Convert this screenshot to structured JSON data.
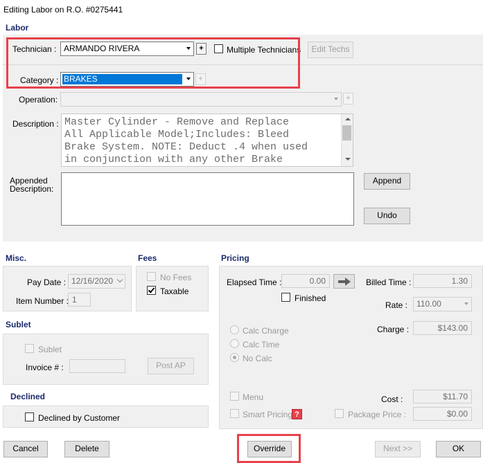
{
  "window": {
    "title": "Editing Labor on R.O. #0275441"
  },
  "labor": {
    "header": "Labor",
    "technician_label": "Technician :",
    "technician_value": "ARMANDO RIVERA",
    "multiple_technicians_label": "Multiple Technicians",
    "edit_techs_label": "Edit Techs",
    "category_label": "Category :",
    "category_value": "BRAKES",
    "operation_label": "Operation:",
    "operation_value": "",
    "description_label": "Description :",
    "description_lines": [
      "Master Cylinder - Remove and Replace",
      "All Applicable Model;Includes: Bleed",
      "Brake System. NOTE: Deduct .4 when used",
      "in conjunction with any other Brake"
    ],
    "appended_label_line1": "Appended",
    "appended_label_line2": "Description:",
    "append_button": "Append",
    "undo_button": "Undo",
    "plus_glyph": "+"
  },
  "misc": {
    "header": "Misc.",
    "pay_date_label": "Pay Date :",
    "pay_date_value": "12/16/2020",
    "item_number_label": "Item Number :",
    "item_number_value": "1"
  },
  "fees": {
    "header": "Fees",
    "no_fees_label": "No Fees",
    "no_fees_checked": false,
    "taxable_label": "Taxable",
    "taxable_checked": true
  },
  "sublet": {
    "header": "Sublet",
    "sublet_label": "Sublet",
    "invoice_label": "Invoice # :",
    "invoice_value": "",
    "post_ap_label": "Post AP"
  },
  "declined": {
    "header": "Declined",
    "declined_by_customer_label": "Declined by Customer",
    "checked": false
  },
  "pricing": {
    "header": "Pricing",
    "elapsed_time_label": "Elapsed Time :",
    "elapsed_time_value": "0.00",
    "finished_label": "Finished",
    "billed_time_label": "Billed Time :",
    "billed_time_value": "1.30",
    "rate_label": "Rate :",
    "rate_value": "110.00",
    "charge_label": "Charge :",
    "charge_value": "$143.00",
    "calc_charge_label": "Calc Charge",
    "calc_time_label": "Calc Time",
    "no_calc_label": "No Calc",
    "selected_calc": "No Calc",
    "menu_label": "Menu",
    "smart_pricing_label": "Smart Pricing",
    "package_price_label": "Package Price :",
    "package_price_value": "$0.00",
    "cost_label": "Cost :",
    "cost_value": "$11.70",
    "help_glyph": "?"
  },
  "footer": {
    "cancel": "Cancel",
    "delete": "Delete",
    "override": "Override",
    "next": "Next >>",
    "ok": "OK"
  },
  "colors": {
    "section_header": "#1a2a6c",
    "highlight_box": "#e8414c",
    "selected_item_bg": "#0078d7"
  }
}
